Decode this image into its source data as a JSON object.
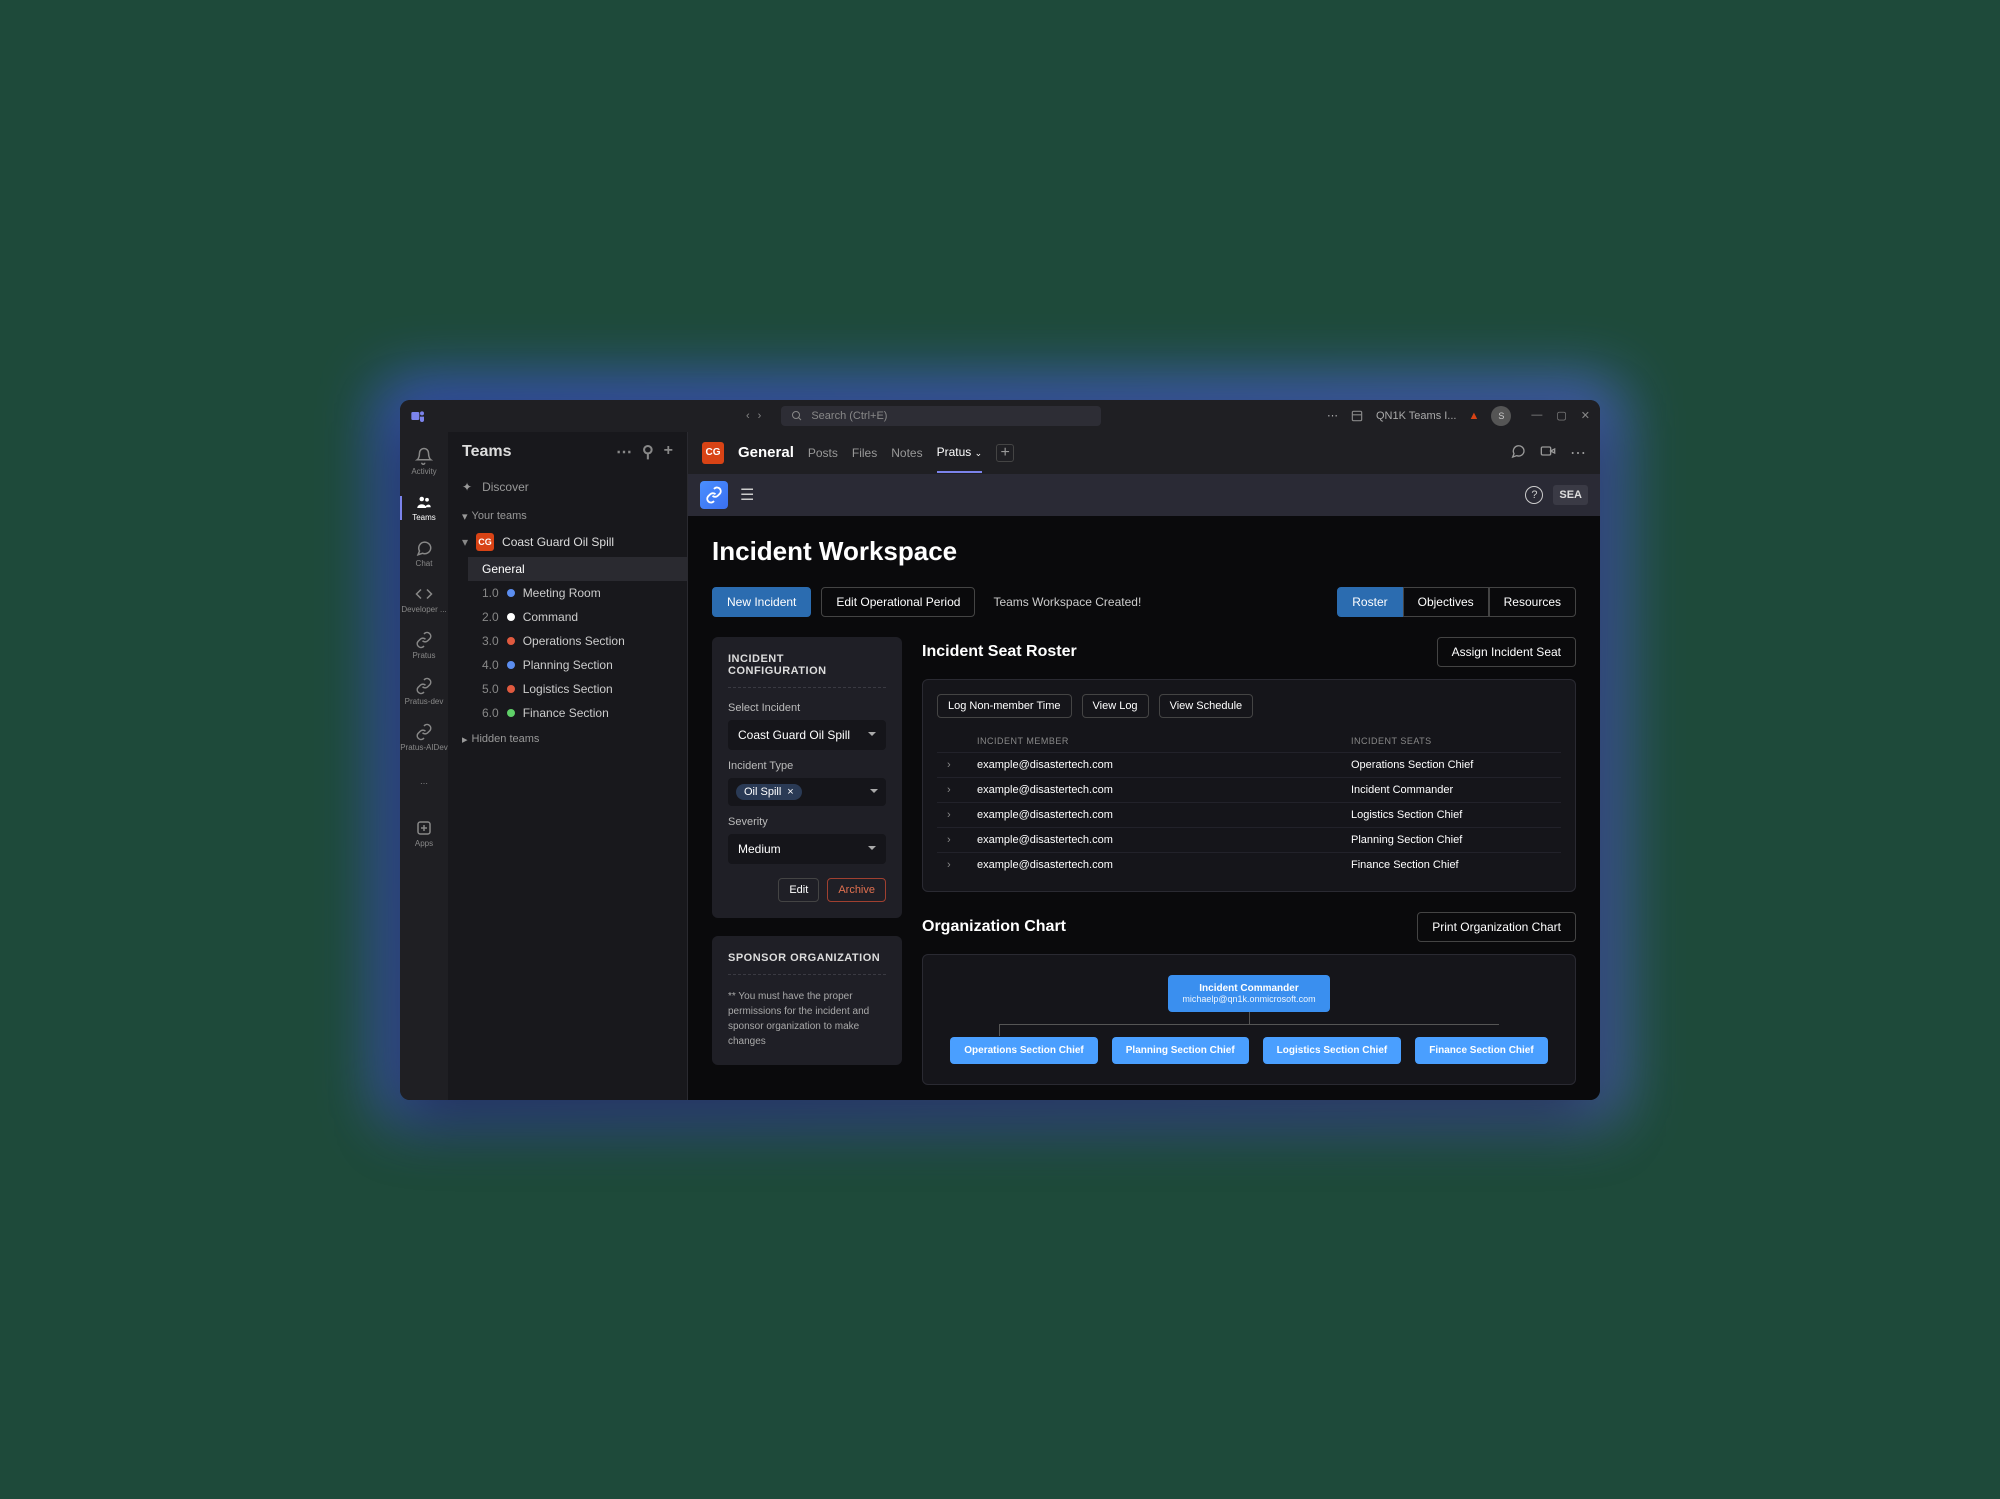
{
  "titlebar": {
    "search_placeholder": "Search (Ctrl+E)",
    "org_label": "QN1K Teams I...",
    "avatar_initial": "S"
  },
  "rail": {
    "items": [
      {
        "label": "Activity"
      },
      {
        "label": "Teams"
      },
      {
        "label": "Chat"
      },
      {
        "label": "Developer ..."
      },
      {
        "label": "Pratus"
      },
      {
        "label": "Pratus-dev"
      },
      {
        "label": "Pratus-AIDev"
      }
    ],
    "apps_label": "Apps"
  },
  "sidebar": {
    "title": "Teams",
    "discover": "Discover",
    "your_teams": "Your teams",
    "team_badge": "CG",
    "team_name": "Coast Guard Oil Spill",
    "channels": [
      {
        "label": "General"
      },
      {
        "num": "1.0",
        "label": "Meeting Room",
        "dot": "blue"
      },
      {
        "num": "2.0",
        "label": "Command",
        "dot": "white"
      },
      {
        "num": "3.0",
        "label": "Operations Section",
        "dot": "red"
      },
      {
        "num": "4.0",
        "label": "Planning Section",
        "dot": "blue"
      },
      {
        "num": "5.0",
        "label": "Logistics Section",
        "dot": "red"
      },
      {
        "num": "6.0",
        "label": "Finance Section",
        "dot": "green"
      }
    ],
    "hidden_teams": "Hidden teams"
  },
  "channel_header": {
    "badge": "CG",
    "title": "General",
    "tabs": [
      "Posts",
      "Files",
      "Notes",
      "Pratus"
    ]
  },
  "app_header": {
    "user_badge": "SEA"
  },
  "page": {
    "title": "Incident Workspace",
    "new_incident": "New Incident",
    "edit_period": "Edit Operational Period",
    "status": "Teams Workspace Created!",
    "view_tabs": [
      "Roster",
      "Objectives",
      "Resources"
    ]
  },
  "config": {
    "title": "INCIDENT CONFIGURATION",
    "select_label": "Select Incident",
    "select_value": "Coast Guard Oil Spill",
    "type_label": "Incident Type",
    "type_tag": "Oil Spill",
    "severity_label": "Severity",
    "severity_value": "Medium",
    "edit": "Edit",
    "archive": "Archive"
  },
  "sponsor": {
    "title": "SPONSOR ORGANIZATION",
    "note": "** You must have the proper permissions for the incident and sponsor organization to make changes"
  },
  "roster": {
    "title": "Incident Seat Roster",
    "assign_btn": "Assign Incident Seat",
    "log_time": "Log Non-member Time",
    "view_log": "View Log",
    "view_schedule": "View Schedule",
    "col_member": "INCIDENT MEMBER",
    "col_seat": "INCIDENT SEATS",
    "rows": [
      {
        "member": "example@disastertech.com",
        "seat": "Operations Section Chief"
      },
      {
        "member": "example@disastertech.com",
        "seat": "Incident Commander"
      },
      {
        "member": "example@disastertech.com",
        "seat": "Logistics Section Chief"
      },
      {
        "member": "example@disastertech.com",
        "seat": "Planning Section Chief"
      },
      {
        "member": "example@disastertech.com",
        "seat": "Finance Section Chief"
      }
    ]
  },
  "org": {
    "title": "Organization Chart",
    "print_btn": "Print Organization Chart",
    "commander": "Incident Commander",
    "commander_email": "michaelp@qn1k.onmicrosoft.com",
    "children": [
      "Operations Section Chief",
      "Planning Section Chief",
      "Logistics Section Chief",
      "Finance Section Chief"
    ]
  }
}
